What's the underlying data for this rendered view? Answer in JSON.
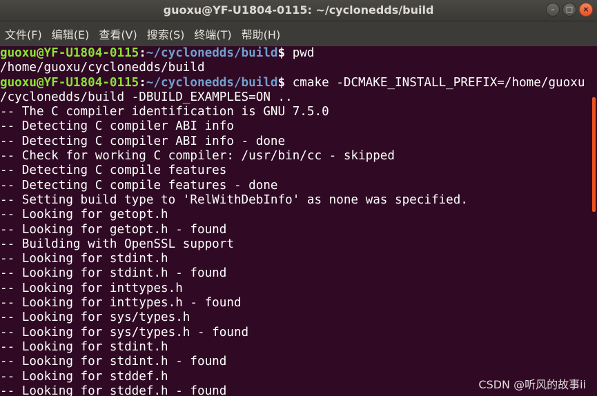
{
  "window": {
    "title": "guoxu@YF-U1804-0115: ~/cyclonedds/build"
  },
  "menu": [
    {
      "label": "文件(F)"
    },
    {
      "label": "编辑(E)"
    },
    {
      "label": "查看(V)"
    },
    {
      "label": "搜索(S)"
    },
    {
      "label": "终端(T)"
    },
    {
      "label": "帮助(H)"
    }
  ],
  "wm_buttons": {
    "minimize_icon": "minimize-icon",
    "maximize_icon": "maximize-icon",
    "close_icon": "close-icon"
  },
  "prompt": {
    "user_host": "guoxu@YF-U1804-0115",
    "colon": ":",
    "path": "~/cyclonedds/build",
    "dollar": "$"
  },
  "terminal": {
    "cmd1": " pwd",
    "out1": "/home/guoxu/cyclonedds/build",
    "cmd2": " cmake -DCMAKE_INSTALL_PREFIX=/home/guoxu",
    "cmd2_cont": "/cyclonedds/build -DBUILD_EXAMPLES=ON ..",
    "output": [
      "-- The C compiler identification is GNU 7.5.0",
      "-- Detecting C compiler ABI info",
      "-- Detecting C compiler ABI info - done",
      "-- Check for working C compiler: /usr/bin/cc - skipped",
      "-- Detecting C compile features",
      "-- Detecting C compile features - done",
      "-- Setting build type to 'RelWithDebInfo' as none was specified.",
      "-- Looking for getopt.h",
      "-- Looking for getopt.h - found",
      "-- Building with OpenSSL support",
      "-- Looking for stdint.h",
      "-- Looking for stdint.h - found",
      "-- Looking for inttypes.h",
      "-- Looking for inttypes.h - found",
      "-- Looking for sys/types.h",
      "-- Looking for sys/types.h - found",
      "-- Looking for stdint.h",
      "-- Looking for stdint.h - found",
      "-- Looking for stddef.h",
      "-- Looking for stddef.h - found"
    ]
  },
  "watermark": "CSDN @听风的故事ii",
  "colors": {
    "background": "#300a24",
    "prompt_user": "#8ae234",
    "prompt_path": "#729fcf",
    "scrollbar_thumb": "#e95420"
  }
}
